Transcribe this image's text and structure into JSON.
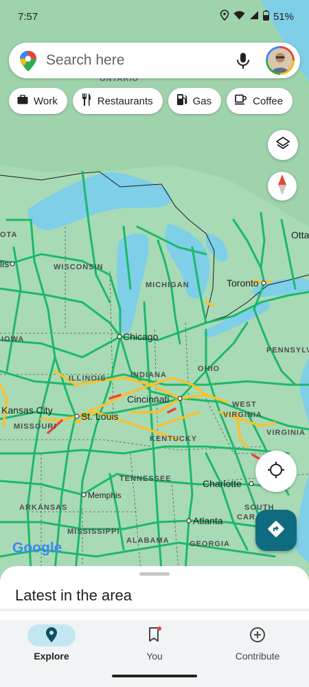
{
  "status_bar": {
    "time": "7:57",
    "battery": "51%"
  },
  "search": {
    "placeholder": "Search here"
  },
  "chips": [
    {
      "label": "Work",
      "icon": "briefcase-icon"
    },
    {
      "label": "Restaurants",
      "icon": "fork-knife-icon"
    },
    {
      "label": "Gas",
      "icon": "gas-pump-icon"
    },
    {
      "label": "Coffee",
      "icon": "coffee-cup-icon"
    }
  ],
  "map": {
    "regions": [
      "ONTARIO",
      "WISCONSIN",
      "MICHIGAN",
      "IOWA",
      "ILLINOIS",
      "INDIANA",
      "OHIO",
      "PENNSYLV",
      "WEST",
      "VIRGINIA",
      "VIRGINIA",
      "MISSOURI",
      "KENTUCKY",
      "TENNESSEE",
      "ARKANSAS",
      "MISSISSIPPI",
      "ALABAMA",
      "GEORGIA",
      "SOUTH",
      "CAR"
    ],
    "cities": [
      "Chicago",
      "Cincinnati",
      "St. Louis",
      "Kansas City",
      "Toronto",
      "Charlotte",
      "Atlanta",
      "Memphis",
      "Otta",
      "OTA",
      "lis"
    ],
    "brand": "Google",
    "colors": {
      "water": "#7fcfe8",
      "land": "#a8dab5",
      "road_free": "#1cb86a",
      "road_slow": "#fbc02d",
      "road_jam": "#e8453c"
    }
  },
  "sheet": {
    "title": "Latest in the area"
  },
  "nav": {
    "explore": "Explore",
    "you": "You",
    "contribute": "Contribute"
  },
  "accent": "#0f6b80"
}
